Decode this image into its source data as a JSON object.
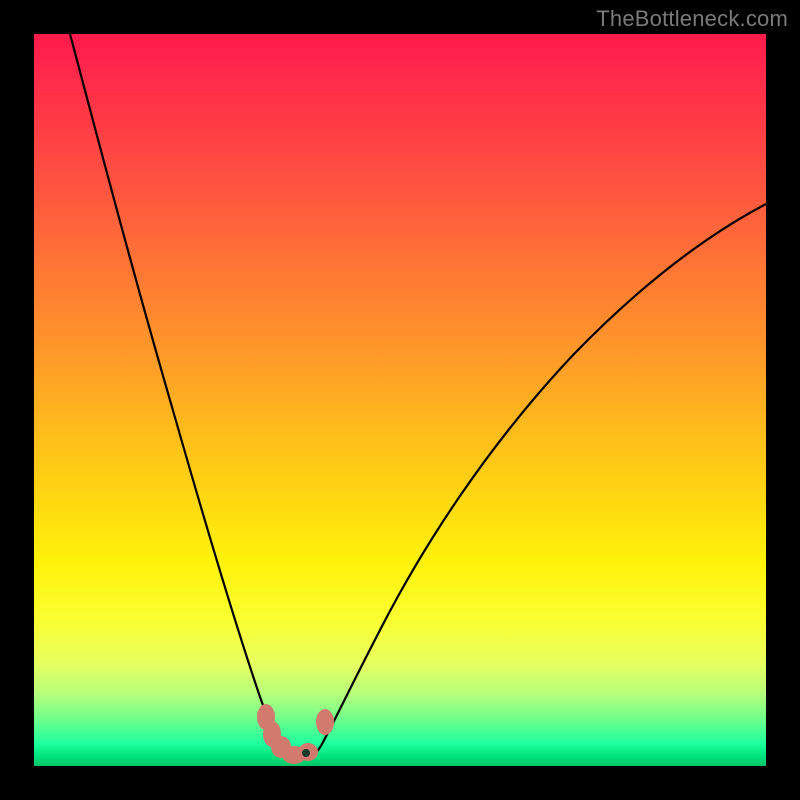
{
  "watermark": "TheBottleneck.com",
  "colors": {
    "frame": "#000000",
    "curve": "#000000",
    "blob": "#d37a6f",
    "minDot": "#1a3a2a"
  },
  "chart_data": {
    "type": "line",
    "title": "",
    "xlabel": "",
    "ylabel": "",
    "xlim": [
      0,
      100
    ],
    "ylim": [
      0,
      100
    ],
    "grid": false,
    "legend": false,
    "series": [
      {
        "name": "bottleneck-curve",
        "x": [
          5,
          8,
          11,
          14,
          17,
          20,
          23,
          26,
          28,
          30,
          31.5,
          33,
          34.5,
          36,
          38,
          41,
          45,
          50,
          56,
          63,
          72,
          82,
          94,
          100
        ],
        "y": [
          100,
          87,
          75,
          63,
          52,
          42,
          32,
          22,
          15,
          9,
          5,
          2.5,
          1.5,
          2,
          4,
          8,
          14,
          22,
          31,
          41,
          52,
          62,
          72,
          76
        ]
      }
    ],
    "minimum": {
      "x": 34,
      "y": 1.3
    },
    "highlight_band": {
      "x_start": 30,
      "x_end": 40,
      "y_low": 1,
      "y_high": 6
    },
    "notes": "Axes are implicit (no ticks or labels rendered). Values estimated from pixel positions; y is inverted (0 at bottom)."
  }
}
